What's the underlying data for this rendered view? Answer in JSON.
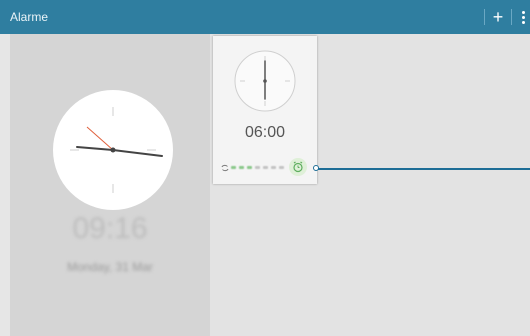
{
  "header": {
    "title": "Alarme",
    "add_label": "+",
    "add_icon": "plus-icon",
    "menu_icon": "more-vertical-icon",
    "bar_color": "#2f7ea0"
  },
  "world_clock": {
    "time": "09:16",
    "date": "Monday, 31 Mar"
  },
  "alarm": {
    "time": "06:00",
    "repeat_icon": "repeat-icon",
    "toggle_icon": "alarm-clock-icon",
    "toggle_color": "#8cc98c"
  }
}
